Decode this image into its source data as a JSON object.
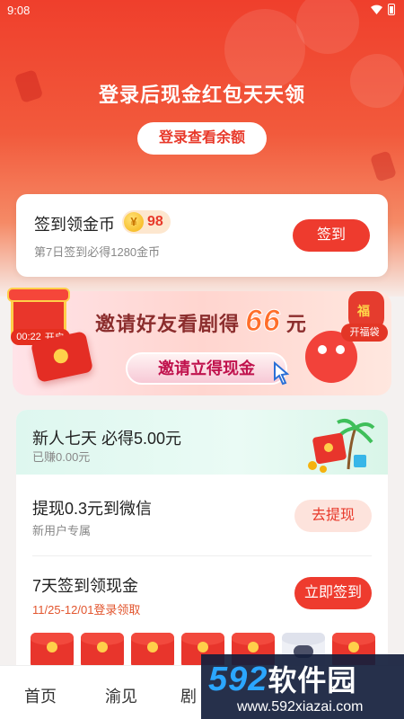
{
  "status_bar": {
    "time": "9:08"
  },
  "hero": {
    "title": "登录后现金红包天天领",
    "button": "登录查看余额"
  },
  "signin": {
    "title": "签到领金币",
    "coin_symbol": "¥",
    "coins": "98",
    "subtitle": "第7日签到必得1280金币",
    "button": "签到"
  },
  "banner": {
    "timer": "00:22",
    "timer_suffix": "开启",
    "invite_prefix": "邀请好友看剧得",
    "invite_amount": "66",
    "invite_suffix": "元",
    "cash_button": "邀请立得现金",
    "luck_bag": "开福袋"
  },
  "tasks": {
    "newbie": {
      "title": "新人七天 必得5.00元",
      "subtitle": "已赚0.00元"
    },
    "withdraw": {
      "title": "提现0.3元到微信",
      "subtitle": "新用户专属",
      "button": "去提现"
    },
    "seven_day": {
      "title": "7天签到领现金",
      "subtitle": "11/25-12/01登录领取",
      "button": "立即签到"
    }
  },
  "bottom_nav": {
    "items": [
      "首页",
      "渝见",
      "剧"
    ]
  },
  "watermark": {
    "logo_num": "592",
    "logo_text": "软件园",
    "url": "www.592xiazai.com"
  },
  "colors": {
    "primary": "#ee3b2e",
    "accent_light": "#fde3dc"
  }
}
